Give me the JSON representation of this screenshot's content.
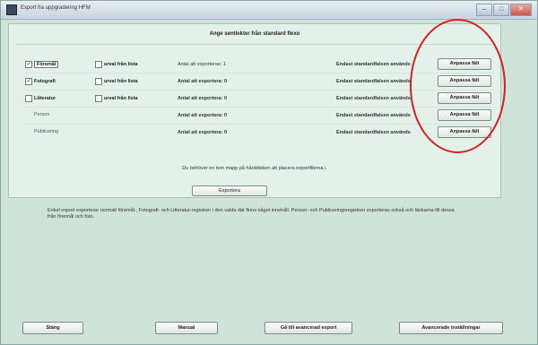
{
  "window": {
    "title": "Export fra uppgradering HFM"
  },
  "panel": {
    "heading": "Ange sentlekter från standard flexo",
    "rows": [
      {
        "label": "Föremål",
        "list_label": "urval från lista",
        "count_text": "Antal att exporteras: 1",
        "status": "Endast standardfalsen används",
        "button": "Anpassa fält",
        "main_checked": true,
        "list_checked": false
      },
      {
        "label": "Fotografi",
        "list_label": "urval från lista",
        "count_text": "Antal att exportera: 0",
        "status": "Endast standardfalsen används",
        "button": "Anpassa fält",
        "main_checked": true,
        "list_checked": false
      },
      {
        "label": "Litteratur",
        "list_label": "urval från lista",
        "count_text": "Antal att exportera: 0",
        "status": "Endast standardfalsen används",
        "button": "Anpassa fält",
        "main_checked": false,
        "list_checked": false
      },
      {
        "label": "Person",
        "list_label": "",
        "count_text": "Antal att exportera: 0",
        "status": "Endast standardfalsen används",
        "button": "Anpassa fält",
        "main_checked": false,
        "list_checked": false
      },
      {
        "label": "Publicering",
        "list_label": "",
        "count_text": "Antal att exportera: 0",
        "status": "Endast standardfalsen används",
        "button": "Anpassa fält",
        "main_checked": false,
        "list_checked": false
      }
    ],
    "info_text": "Du behöver en tom mapp på hårddisken att placera exportfilerna i.",
    "export_button": "Exportera"
  },
  "description": "Enkel export exporterar normalt föremål-, Fotografi- och Litteratur-registren i den valda där finns något innehåll. Person- och Publiceringsregistren exporteras också och länkarna till dessa från föremål och foto.",
  "bottom_buttons": {
    "close": "Stäng",
    "manual": "Manual",
    "advanced_export": "Gå till avancerad export",
    "advanced_settings": "Avancerade inställningar"
  },
  "colors": {
    "window_bg": "#cfe3d9",
    "panel_bg": "#e3f1ea",
    "annotation": "#d62020"
  }
}
